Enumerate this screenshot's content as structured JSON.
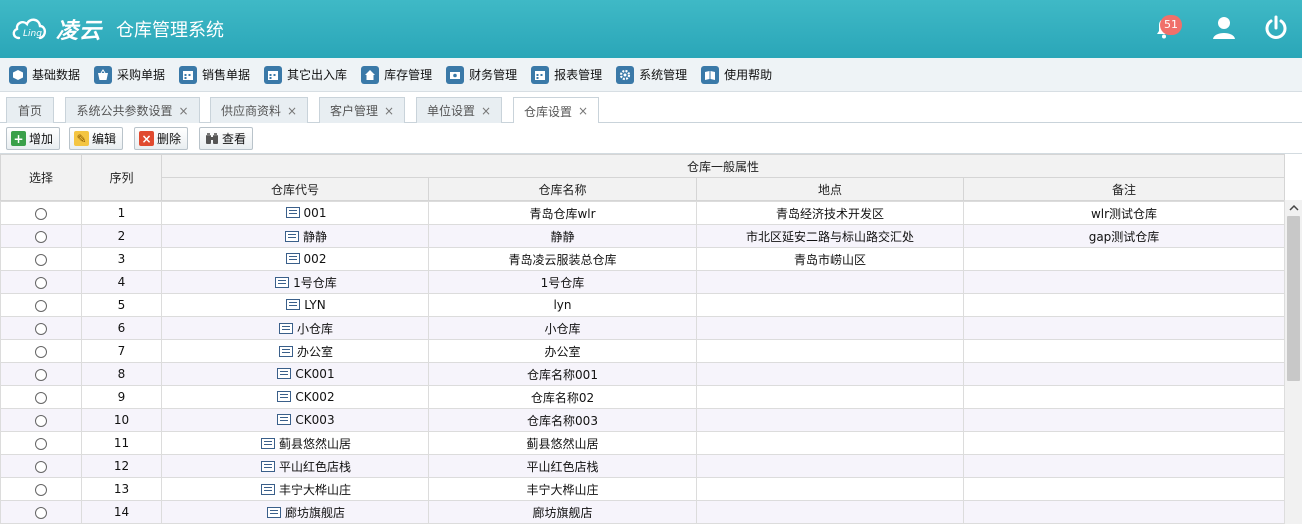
{
  "header": {
    "brand": "凌云",
    "logo_sub": "Ling",
    "system_name": "仓库管理系统",
    "notification_count": "51",
    "colors": {
      "bar": "#2aa6b8",
      "badge": "#f0706a"
    }
  },
  "menu": [
    {
      "label": "基础数据",
      "icon": "cube-icon"
    },
    {
      "label": "采购单据",
      "icon": "basket-icon"
    },
    {
      "label": "销售单据",
      "icon": "calendar-icon"
    },
    {
      "label": "其它出入库",
      "icon": "calendar-icon"
    },
    {
      "label": "库存管理",
      "icon": "home-icon"
    },
    {
      "label": "财务管理",
      "icon": "money-icon"
    },
    {
      "label": "报表管理",
      "icon": "calendar-icon"
    },
    {
      "label": "系统管理",
      "icon": "gear-icon"
    },
    {
      "label": "使用帮助",
      "icon": "book-icon"
    }
  ],
  "tabs": [
    {
      "label": "首页",
      "closable": false
    },
    {
      "label": "系统公共参数设置",
      "closable": true
    },
    {
      "label": "供应商资料",
      "closable": true
    },
    {
      "label": "客户管理",
      "closable": true
    },
    {
      "label": "单位设置",
      "closable": true
    },
    {
      "label": "仓库设置",
      "closable": true,
      "active": true
    }
  ],
  "toolbar": {
    "add": "增加",
    "edit": "编辑",
    "delete": "删除",
    "view": "查看"
  },
  "table": {
    "headers": {
      "select": "选择",
      "seq": "序列",
      "group": "仓库一般属性",
      "code": "仓库代号",
      "name": "仓库名称",
      "location": "地点",
      "remark": "备注"
    },
    "rows": [
      {
        "seq": "1",
        "code": "001",
        "name": "青岛仓库wlr",
        "location": "青岛经济技术开发区",
        "remark": "wlr测试仓库"
      },
      {
        "seq": "2",
        "code": "静静",
        "name": "静静",
        "location": "市北区延安二路与标山路交汇处",
        "remark": "gap测试仓库"
      },
      {
        "seq": "3",
        "code": "002",
        "name": "青岛凌云服装总仓库",
        "location": "青岛市崂山区",
        "remark": ""
      },
      {
        "seq": "4",
        "code": "1号仓库",
        "name": "1号仓库",
        "location": "",
        "remark": ""
      },
      {
        "seq": "5",
        "code": "LYN",
        "name": "lyn",
        "location": "",
        "remark": ""
      },
      {
        "seq": "6",
        "code": "小仓库",
        "name": "小仓库",
        "location": "",
        "remark": ""
      },
      {
        "seq": "7",
        "code": "办公室",
        "name": "办公室",
        "location": "",
        "remark": ""
      },
      {
        "seq": "8",
        "code": "CK001",
        "name": "仓库名称001",
        "location": "",
        "remark": ""
      },
      {
        "seq": "9",
        "code": "CK002",
        "name": "仓库名称02",
        "location": "",
        "remark": ""
      },
      {
        "seq": "10",
        "code": "CK003",
        "name": "仓库名称003",
        "location": "",
        "remark": ""
      },
      {
        "seq": "11",
        "code": "蓟县悠然山居",
        "name": "蓟县悠然山居",
        "location": "",
        "remark": ""
      },
      {
        "seq": "12",
        "code": "平山红色店栈",
        "name": "平山红色店栈",
        "location": "",
        "remark": ""
      },
      {
        "seq": "13",
        "code": "丰宁大桦山庄",
        "name": "丰宁大桦山庄",
        "location": "",
        "remark": ""
      },
      {
        "seq": "14",
        "code": "廊坊旗舰店",
        "name": "廊坊旗舰店",
        "location": "",
        "remark": ""
      }
    ]
  }
}
